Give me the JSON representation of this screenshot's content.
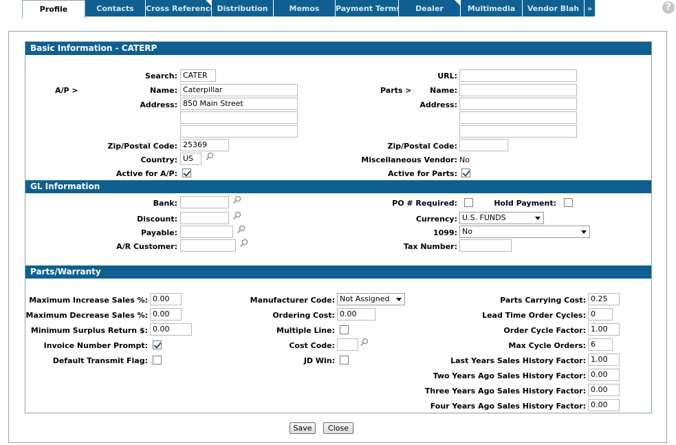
{
  "tabs": [
    {
      "label": "Profile",
      "active": true
    },
    {
      "label": "Contacts"
    },
    {
      "label": "Cross Reference"
    },
    {
      "label": "Distribution"
    },
    {
      "label": "Memos"
    },
    {
      "label": "Payment Terms"
    },
    {
      "label": "Dealer"
    },
    {
      "label": "Multimedia"
    },
    {
      "label": "Vendor Blah"
    },
    {
      "label": "»"
    }
  ],
  "help_icon": "?",
  "basic": {
    "title": "Basic Information -  CATERP",
    "ap_label": "A/P >",
    "parts_label": "Parts >",
    "search_label": "Search:",
    "search_value": "CATER",
    "name_label": "Name:",
    "name_value": "Caterpillar",
    "address_label": "Address:",
    "address1": "850 Main Street",
    "address2": "",
    "address3": "",
    "zip_label": "Zip/Postal Code:",
    "zip_value": "25369",
    "country_label": "Country:",
    "country_value": "US",
    "active_ap_label": "Active for A/P:",
    "active_ap": true,
    "url_label": "URL:",
    "url_value": "",
    "parts_name_label": "Name:",
    "parts_name_value": "",
    "parts_address_label": "Address:",
    "parts_zip_label": "Zip/Postal Code:",
    "parts_zip_value": "",
    "misc_vendor_label": "Miscellaneous Vendor:",
    "misc_vendor_value": "No",
    "active_parts_label": "Active for Parts:",
    "active_parts": true
  },
  "gl": {
    "title": "GL Information",
    "bank_label": "Bank:",
    "bank_value": "",
    "discount_label": "Discount:",
    "discount_value": "",
    "payable_label": "Payable:",
    "payable_value": "",
    "ar_label": "A/R Customer:",
    "ar_value": "",
    "po_label": "PO # Required:",
    "po_required": false,
    "hold_label": "Hold Payment:",
    "hold_payment": false,
    "currency_label": "Currency:",
    "currency_value": "U.S. FUNDS",
    "t1099_label": "1099:",
    "t1099_value": "No",
    "tax_label": "Tax Number:",
    "tax_value": ""
  },
  "parts": {
    "title": "Parts/Warranty",
    "max_inc_label": "Maximum Increase Sales %:",
    "max_inc_value": "0.00",
    "max_dec_label": "Maximum Decrease Sales %:",
    "max_dec_value": "0.00",
    "min_surplus_label": "Minimum Surplus Return $:",
    "min_surplus_value": "0.00",
    "invoice_prompt_label": "Invoice Number Prompt:",
    "invoice_prompt": true,
    "transmit_label": "Default Transmit Flag:",
    "transmit": false,
    "mfr_label": "Manufacturer Code:",
    "mfr_value": "Not Assigned",
    "ordering_label": "Ordering Cost:",
    "ordering_value": "0.00",
    "multiline_label": "Multiple Line:",
    "multiline": false,
    "costcode_label": "Cost Code:",
    "costcode_value": "",
    "jdwin_label": "JD Win:",
    "jdwin": false,
    "carrying_label": "Parts Carrying Cost:",
    "carrying_value": "0.25",
    "leadtime_label": "Lead Time Order Cycles:",
    "leadtime_value": "0",
    "cycle_factor_label": "Order Cycle Factor:",
    "cycle_factor_value": "1.00",
    "max_cycle_label": "Max Cycle Orders:",
    "max_cycle_value": "6",
    "last_year_label": "Last Years Sales History Factor:",
    "last_year_value": "1.00",
    "two_year_label": "Two Years Ago Sales History Factor:",
    "two_year_value": "0.00",
    "three_year_label": "Three Years Ago Sales History Factor:",
    "three_year_value": "0.00",
    "four_year_label": "Four Years Ago Sales History Factor:",
    "four_year_value": "0.00"
  },
  "buttons": {
    "save": "Save",
    "close": "Close"
  }
}
